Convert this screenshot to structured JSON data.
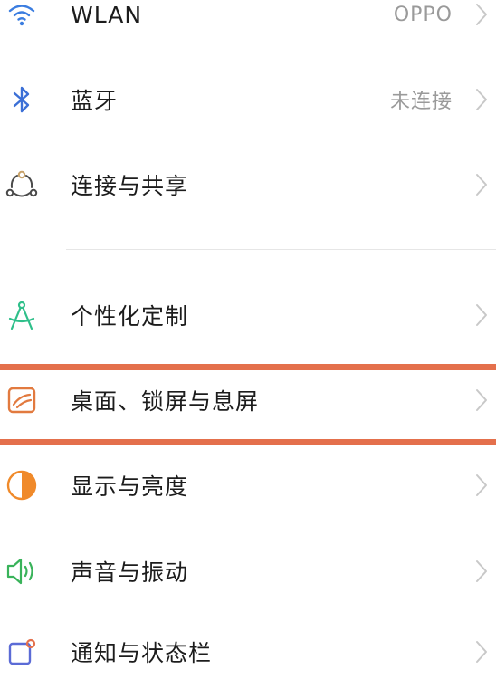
{
  "colors": {
    "highlight": "#e4704c",
    "wifi_icon": "#3b7de0",
    "bluetooth_icon": "#3b6fd6",
    "connection_icon": "#c9a36a",
    "personalize_icon": "#2fbf8a",
    "desktop_icon": "#e27a3f",
    "display_icon": "#f08a2a",
    "sound_icon": "#39b35a",
    "notification_icon": "#5b6bd6"
  },
  "settings": {
    "wlan": {
      "label": "WLAN",
      "value": "OPPO"
    },
    "bluetooth": {
      "label": "蓝牙",
      "value": "未连接"
    },
    "connection": {
      "label": "连接与共享"
    },
    "personalize": {
      "label": "个性化定制"
    },
    "desktop": {
      "label": "桌面、锁屏与息屏"
    },
    "display": {
      "label": "显示与亮度"
    },
    "sound": {
      "label": "声音与振动"
    },
    "notification": {
      "label": "通知与状态栏"
    }
  }
}
